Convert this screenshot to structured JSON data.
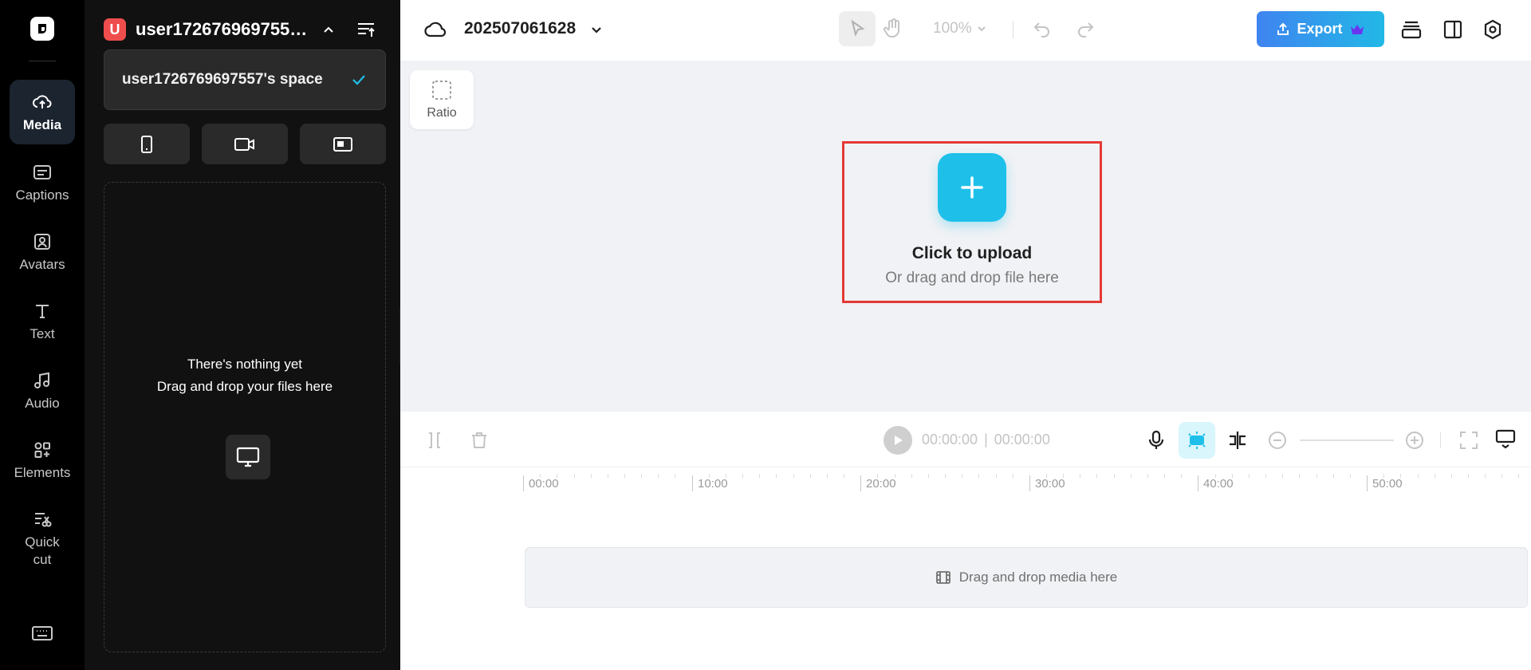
{
  "rail": {
    "items": [
      {
        "id": "media",
        "label": "Media",
        "icon": "cloud-upload-icon",
        "active": true
      },
      {
        "id": "captions",
        "label": "Captions",
        "icon": "captions-icon",
        "active": false
      },
      {
        "id": "avatars",
        "label": "Avatars",
        "icon": "avatar-icon",
        "active": false
      },
      {
        "id": "text",
        "label": "Text",
        "icon": "text-icon",
        "active": false
      },
      {
        "id": "audio",
        "label": "Audio",
        "icon": "music-note-icon",
        "active": false
      },
      {
        "id": "elements",
        "label": "Elements",
        "icon": "elements-icon",
        "active": false
      },
      {
        "id": "quickcut",
        "label": "Quick\ncut",
        "icon": "quick-cut-icon",
        "active": false
      }
    ]
  },
  "panel": {
    "workspace_initial": "U",
    "workspace_name": "user1726769697557's space",
    "dropdown_workspace": "user1726769697557's space",
    "empty_line1": "There's nothing yet",
    "empty_line2": "Drag and drop your files here"
  },
  "topbar": {
    "project_name": "202507061628",
    "zoom": "100%",
    "export_label": "Export"
  },
  "canvas": {
    "ratio_label": "Ratio",
    "upload_title": "Click to upload",
    "upload_subtitle": "Or drag and drop file here"
  },
  "timeline": {
    "current_time": "00:00:00",
    "total_time": "00:00:00",
    "ruler_labels": [
      "00:00",
      "10:00",
      "20:00",
      "30:00",
      "40:00",
      "50:00"
    ],
    "track_placeholder": "Drag and drop media here"
  },
  "colors": {
    "accent": "#1ec0ea",
    "export_gradient_start": "#3f84f0",
    "export_gradient_end": "#22b8e6",
    "highlight_border": "#e53935",
    "avatar_bg": "#ef4d4d"
  }
}
